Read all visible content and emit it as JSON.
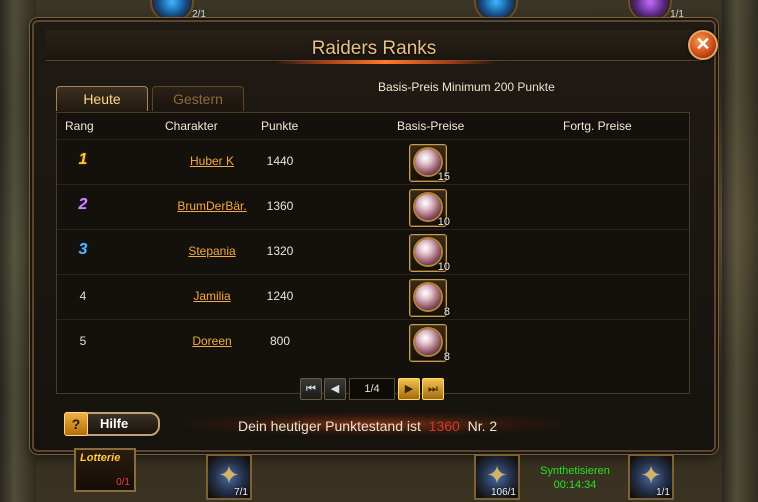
{
  "window": {
    "title": "Raiders Ranks",
    "close_symbol": "✕"
  },
  "tabs": {
    "today": "Heute",
    "yesterday": "Gestern"
  },
  "info": {
    "label": "Basis-Preis Minimum",
    "value": "200 Punkte"
  },
  "columns": {
    "rank": "Rang",
    "character": "Charakter",
    "points": "Punkte",
    "base_prizes": "Basis-Preise",
    "advanced_prizes": "Fortg. Preise"
  },
  "rows": [
    {
      "rank": "1",
      "name": "Huber K",
      "points": "1440",
      "prize_qty": "15"
    },
    {
      "rank": "2",
      "name": "BrumDerBär.",
      "points": "1360",
      "prize_qty": "10"
    },
    {
      "rank": "3",
      "name": "Stepania",
      "points": "1320",
      "prize_qty": "10"
    },
    {
      "rank": "4",
      "name": "Jamilia",
      "points": "1240",
      "prize_qty": "8"
    },
    {
      "rank": "5",
      "name": "Doreen",
      "points": "800",
      "prize_qty": "8"
    }
  ],
  "pager": {
    "page": "1/4",
    "first": "⏮",
    "prev": "◀",
    "next": "▶",
    "last": "⏭"
  },
  "help": {
    "icon": "?",
    "label": "Hilfe"
  },
  "footer": {
    "prefix": "Dein heutiger Punktestand ist",
    "score": "1360",
    "rank": "Nr. 2"
  },
  "bottom_bar": {
    "lottery_label": "Lotterie",
    "lottery_count": "0/1",
    "slot1_count": "7/1",
    "slot2_count": "106/1",
    "synth_label": "Synthetisieren",
    "synth_timer": "00:14:34",
    "slot3_count": "1/1"
  },
  "top_bar": {
    "left_count": "2/1",
    "right_count": "1/1"
  },
  "colors": {
    "accent": "#e8c184",
    "link": "#f5a843",
    "score": "#d03c2c",
    "gold": "#ffc832",
    "purple": "#d08aff",
    "blue": "#5ab4ff"
  }
}
